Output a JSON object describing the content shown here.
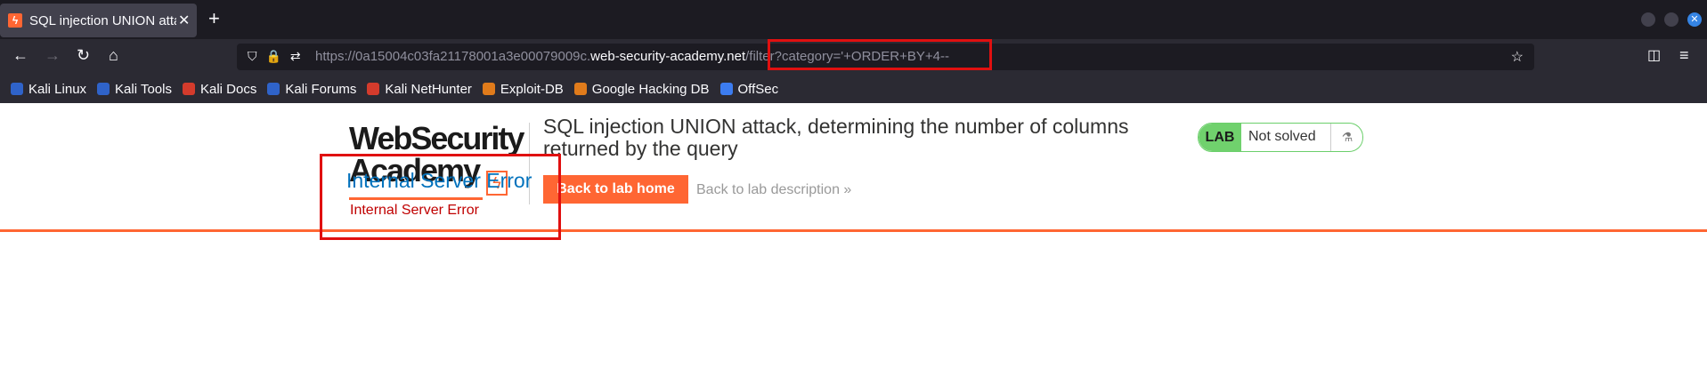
{
  "tab": {
    "title": "SQL injection UNION attac",
    "favicon": "portswigger-favicon-icon"
  },
  "url": {
    "prefix": "https://0a15004c03fa21178001a3e00079009c.",
    "domain": "web-security-academy.net",
    "path": "/filter?category='+ORDER+BY+4--"
  },
  "bookmarks": [
    {
      "label": "Kali Linux",
      "color": "#2f63c9"
    },
    {
      "label": "Kali Tools",
      "color": "#2f63c9"
    },
    {
      "label": "Kali Docs",
      "color": "#d43b2c"
    },
    {
      "label": "Kali Forums",
      "color": "#2f63c9"
    },
    {
      "label": "Kali NetHunter",
      "color": "#d43b2c"
    },
    {
      "label": "Exploit-DB",
      "color": "#e07b1b"
    },
    {
      "label": "Google Hacking DB",
      "color": "#e07b1b"
    },
    {
      "label": "OffSec",
      "color": "#3c7cf0"
    }
  ],
  "header": {
    "logo_line1": "WebSecurity",
    "logo_line2": "Academy",
    "title": "SQL injection UNION attack, determining the number of columns returned by the query",
    "back_button": "Back to lab home",
    "back_description": "Back to lab description »",
    "status_badge": "LAB",
    "status_text": "Not solved"
  },
  "error": {
    "title": "Internal Server Error",
    "message": "Internal Server Error"
  },
  "colors": {
    "accent": "#ff6633",
    "error_border": "#e01010",
    "link_blue": "#0071bc",
    "error_text": "#c00000",
    "lab_green": "#70d16d"
  }
}
